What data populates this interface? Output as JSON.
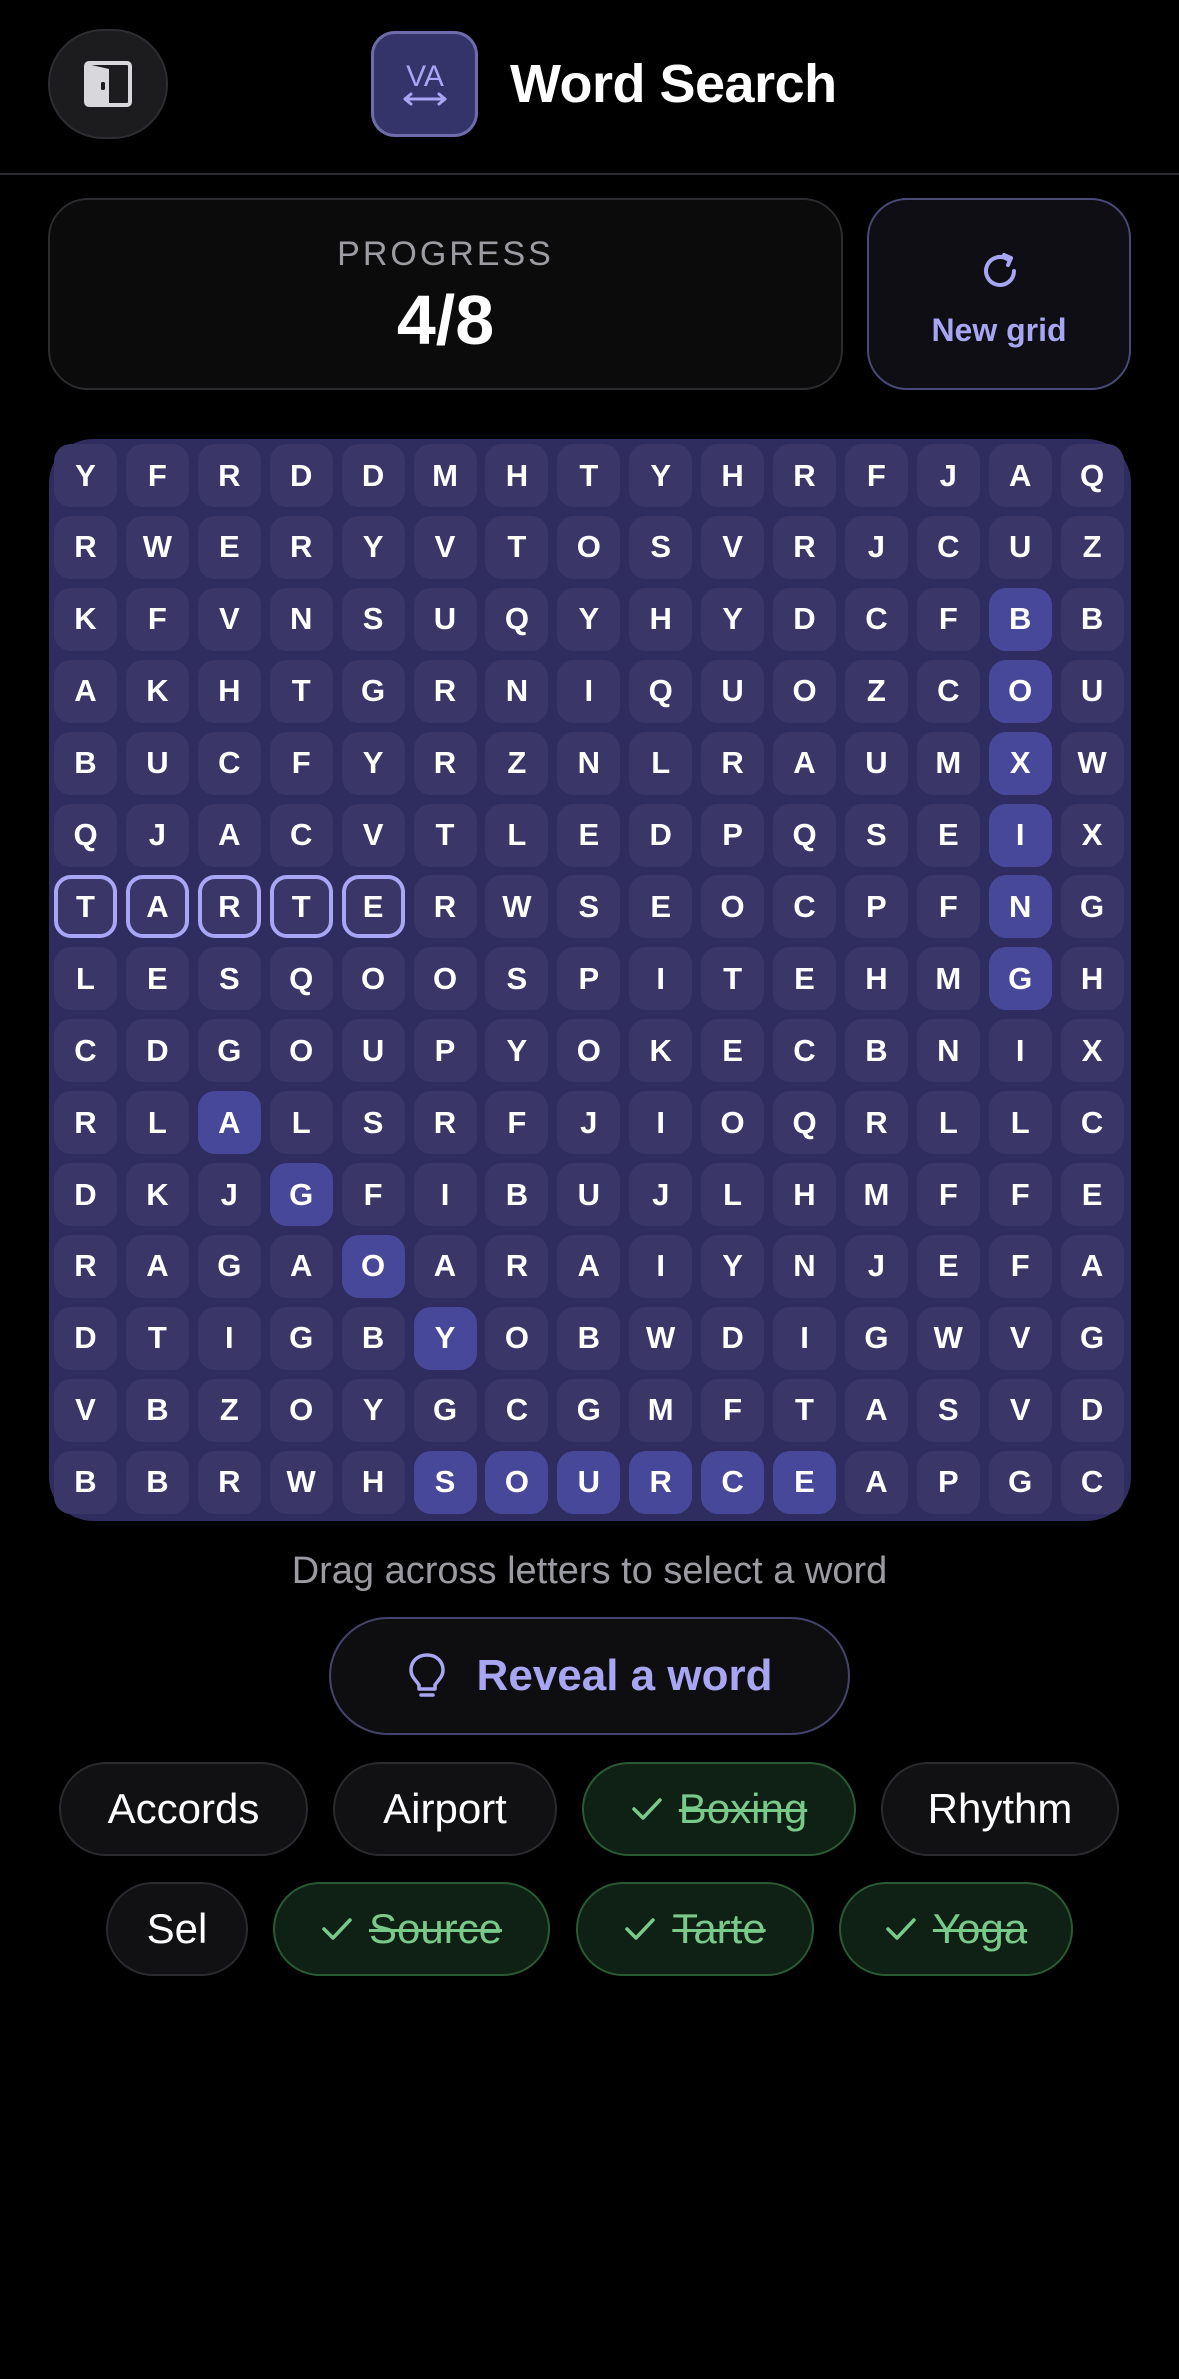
{
  "header": {
    "title": "Word Search",
    "logo_icon": "translate-icon",
    "exit_icon": "exit-door-icon"
  },
  "progress": {
    "label": "PROGRESS",
    "value": "4/8",
    "found": 4,
    "total": 8
  },
  "new_grid": {
    "label": "New grid",
    "icon": "refresh-icon"
  },
  "grid": {
    "rows": [
      "YFRDDMHTYHRFJAQ",
      "RWERYVTOSVRJCUZ",
      "KFVNSUQYHYDCFBB",
      "AKHTGRNIQUOZCOU",
      "BUCFYRZNLRAUMXW",
      "QJACVTLEDPQSEIX",
      "TARTERWSEOCPFNG",
      "LESQOOSPITEHMGH",
      "CDGOUPYOKECBNIX",
      "RLALSRFJIOQRLLC",
      "DKJGFIBUJLHMFFE",
      "RAGAOARAIYNJEFA",
      "DTIGBYOBWDIGWVG",
      "VBZOYGCGMFTASVD",
      "BBRWHSOURCEAPGC"
    ],
    "found_cells": [
      [
        2,
        13
      ],
      [
        3,
        13
      ],
      [
        4,
        13
      ],
      [
        5,
        13
      ],
      [
        6,
        13
      ],
      [
        7,
        13
      ],
      [
        9,
        2
      ],
      [
        10,
        3
      ],
      [
        11,
        4
      ],
      [
        12,
        5
      ],
      [
        14,
        5
      ],
      [
        14,
        6
      ],
      [
        14,
        7
      ],
      [
        14,
        8
      ],
      [
        14,
        9
      ],
      [
        14,
        10
      ]
    ],
    "selected_cells": [
      [
        6,
        0
      ],
      [
        6,
        1
      ],
      [
        6,
        2
      ],
      [
        6,
        3
      ],
      [
        6,
        4
      ]
    ]
  },
  "hint": "Drag across letters to select a word",
  "reveal": {
    "label": "Reveal a word",
    "icon": "lightbulb-icon"
  },
  "words": [
    {
      "label": "Accords",
      "found": false
    },
    {
      "label": "Airport",
      "found": false
    },
    {
      "label": "Boxing",
      "found": true
    },
    {
      "label": "Rhythm",
      "found": false
    },
    {
      "label": "Sel",
      "found": false
    },
    {
      "label": "Source",
      "found": true
    },
    {
      "label": "Tarte",
      "found": true
    },
    {
      "label": "Yoga",
      "found": true
    }
  ],
  "colors": {
    "accent": "#a8a6f2",
    "grid_bg": "#2f2c5f",
    "cell": "#3a3768",
    "found_cell": "#48489a",
    "found_chip": "#78c98a"
  }
}
